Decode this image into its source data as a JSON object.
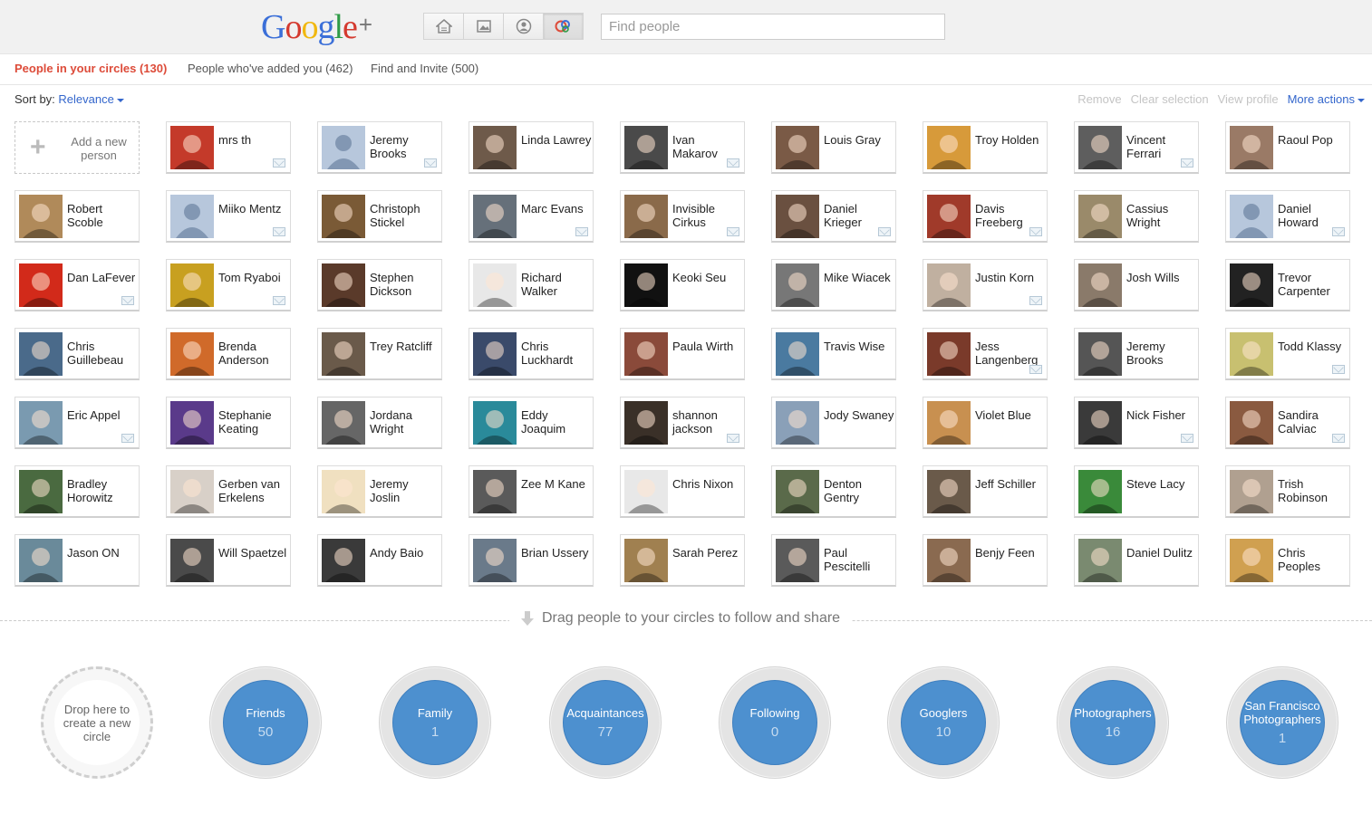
{
  "brand": {
    "logo_letters": [
      "G",
      "o",
      "o",
      "g",
      "l",
      "e"
    ],
    "plus": "+"
  },
  "nav": [
    {
      "name": "home-icon",
      "active": false
    },
    {
      "name": "photos-icon",
      "active": false
    },
    {
      "name": "profile-icon",
      "active": false
    },
    {
      "name": "circles-icon",
      "active": true
    }
  ],
  "search": {
    "placeholder": "Find people",
    "value": ""
  },
  "tabs": [
    {
      "label": "People in your circles (130)",
      "active": true
    },
    {
      "label": "People who've added you (462)",
      "active": false
    },
    {
      "label": "Find and Invite (500)",
      "active": false
    }
  ],
  "sort": {
    "label": "Sort by:",
    "value": "Relevance"
  },
  "actions": {
    "remove": "Remove",
    "clear": "Clear selection",
    "view": "View profile",
    "more": "More actions"
  },
  "add_card": {
    "line1": "Add a new",
    "line2": "person"
  },
  "people": [
    {
      "name": "mrs th",
      "mail": true,
      "color": "#c43a2a"
    },
    {
      "name": "Jeremy Brooks",
      "mail": true,
      "color": "#9fb4cf",
      "default": true
    },
    {
      "name": "Linda Lawrey",
      "mail": false,
      "color": "#6e5a4a"
    },
    {
      "name": "Ivan Makarov",
      "mail": true,
      "color": "#4a4a4a"
    },
    {
      "name": "Louis Gray",
      "mail": false,
      "color": "#7a5a46"
    },
    {
      "name": "Troy Holden",
      "mail": false,
      "color": "#d79a3a"
    },
    {
      "name": "Vincent Ferrari",
      "mail": true,
      "color": "#5e5e5e"
    },
    {
      "name": "Raoul Pop",
      "mail": false,
      "color": "#9a7a66"
    },
    {
      "name": "Robert Scoble",
      "mail": false,
      "color": "#b08a5a"
    },
    {
      "name": "Miiko Mentz",
      "mail": true,
      "color": "#9fb4cf",
      "default": true
    },
    {
      "name": "Christoph Stickel",
      "mail": false,
      "color": "#7a5a36"
    },
    {
      "name": "Marc Evans",
      "mail": true,
      "color": "#66707a"
    },
    {
      "name": "Invisible Cirkus",
      "mail": true,
      "color": "#8a6a4a"
    },
    {
      "name": "Daniel Krieger",
      "mail": true,
      "color": "#6a5040"
    },
    {
      "name": "Davis Freeberg",
      "mail": true,
      "color": "#a03a2a"
    },
    {
      "name": "Cassius Wright",
      "mail": false,
      "color": "#9a8a6a"
    },
    {
      "name": "Daniel Howard",
      "mail": true,
      "color": "#9fb4cf",
      "default": true
    },
    {
      "name": "Dan LaFever",
      "mail": true,
      "color": "#d22a1a"
    },
    {
      "name": "Tom Ryaboi",
      "mail": true,
      "color": "#c8a020"
    },
    {
      "name": "Stephen Dickson",
      "mail": false,
      "color": "#5a3a2a"
    },
    {
      "name": "Richard Walker",
      "mail": false,
      "color": "#e8e8e8"
    },
    {
      "name": "Keoki Seu",
      "mail": false,
      "color": "#111111"
    },
    {
      "name": "Mike Wiacek",
      "mail": false,
      "color": "#777777"
    },
    {
      "name": "Justin Korn",
      "mail": true,
      "color": "#c0b0a0"
    },
    {
      "name": "Josh Wills",
      "mail": false,
      "color": "#8a7a6a"
    },
    {
      "name": "Trevor Carpenter",
      "mail": false,
      "color": "#222222"
    },
    {
      "name": "Chris Guillebeau",
      "mail": false,
      "color": "#4a6a8a"
    },
    {
      "name": "Brenda Anderson",
      "mail": false,
      "color": "#d06a2a"
    },
    {
      "name": "Trey Ratcliff",
      "mail": false,
      "color": "#6a5a4a"
    },
    {
      "name": "Chris Luckhardt",
      "mail": false,
      "color": "#3a4a6a"
    },
    {
      "name": "Paula Wirth",
      "mail": false,
      "color": "#8a4a3a"
    },
    {
      "name": "Travis Wise",
      "mail": false,
      "color": "#4a7aa0"
    },
    {
      "name": "Jess Langenberg",
      "mail": true,
      "color": "#7a3a2a"
    },
    {
      "name": "Jeremy Brooks",
      "mail": false,
      "color": "#555555"
    },
    {
      "name": "Todd Klassy",
      "mail": true,
      "color": "#c8c070"
    },
    {
      "name": "Eric Appel",
      "mail": true,
      "color": "#7a9ab0"
    },
    {
      "name": "Stephanie Keating",
      "mail": false,
      "color": "#5a3a8a"
    },
    {
      "name": "Jordana Wright",
      "mail": false,
      "color": "#666666"
    },
    {
      "name": "Eddy Joaquim",
      "mail": false,
      "color": "#2a8a9a"
    },
    {
      "name": "shannon jackson",
      "mail": true,
      "color": "#3a3028"
    },
    {
      "name": "Jody Swaney",
      "mail": false,
      "color": "#8aa0b8"
    },
    {
      "name": "Violet Blue",
      "mail": false,
      "color": "#c89050"
    },
    {
      "name": "Nick Fisher",
      "mail": true,
      "color": "#3a3a3a"
    },
    {
      "name": "Sandira Calviac",
      "mail": true,
      "color": "#8a5a40"
    },
    {
      "name": "Bradley Horowitz",
      "mail": false,
      "color": "#4a6a40"
    },
    {
      "name": "Gerben van Erkelens",
      "mail": false,
      "color": "#d8d0c8"
    },
    {
      "name": "Jeremy Joslin",
      "mail": false,
      "color": "#f0e0c0"
    },
    {
      "name": "Zee M Kane",
      "mail": false,
      "color": "#5a5a5a"
    },
    {
      "name": "Chris Nixon",
      "mail": false,
      "color": "#e8e8e8"
    },
    {
      "name": "Denton Gentry",
      "mail": false,
      "color": "#5a6a4a"
    },
    {
      "name": "Jeff Schiller",
      "mail": false,
      "color": "#6a5a4a"
    },
    {
      "name": "Steve Lacy",
      "mail": false,
      "color": "#3a8a3a"
    },
    {
      "name": "Trish Robinson",
      "mail": false,
      "color": "#b0a090"
    },
    {
      "name": "Jason ON",
      "mail": false,
      "color": "#6a8a9a"
    },
    {
      "name": "Will Spaetzel",
      "mail": false,
      "color": "#4a4a4a"
    },
    {
      "name": "Andy Baio",
      "mail": false,
      "color": "#3a3a3a"
    },
    {
      "name": "Brian Ussery",
      "mail": false,
      "color": "#6a7a8a"
    },
    {
      "name": "Sarah Perez",
      "mail": false,
      "color": "#a08050"
    },
    {
      "name": "Paul Pescitelli",
      "mail": false,
      "color": "#5a5a5a"
    },
    {
      "name": "Benjy Feen",
      "mail": false,
      "color": "#8a6a50"
    },
    {
      "name": "Daniel Dulitz",
      "mail": false,
      "color": "#7a8a70"
    },
    {
      "name": "Chris Peoples",
      "mail": false,
      "color": "#d0a050"
    }
  ],
  "drag_message": "Drag people to your circles to follow and share",
  "new_circle": {
    "line1": "Drop here to",
    "line2": "create a new",
    "line3": "circle"
  },
  "circles": [
    {
      "name": "Friends",
      "count": "50"
    },
    {
      "name": "Family",
      "count": "1"
    },
    {
      "name": "Acquaintances",
      "count": "77"
    },
    {
      "name": "Following",
      "count": "0"
    },
    {
      "name": "Googlers",
      "count": "10"
    },
    {
      "name": "Photographers",
      "count": "16"
    },
    {
      "name": "San Francisco Photographers",
      "count": "1"
    }
  ],
  "colors": {
    "accent_red": "#dd4b39",
    "link_blue": "#3366cc",
    "circle_blue": "#4d90cf"
  }
}
